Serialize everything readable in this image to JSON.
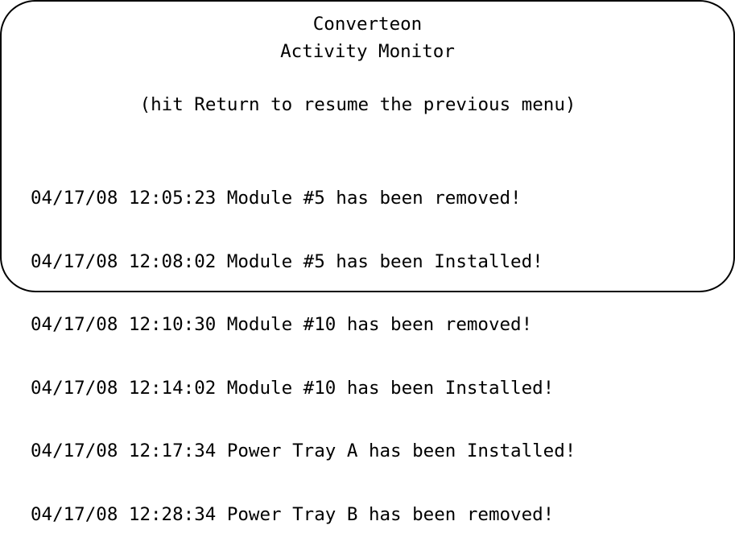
{
  "header": {
    "title": "Converteon",
    "subtitle": "Activity Monitor"
  },
  "hint": "(hit Return to resume the previous menu)",
  "log": [
    {
      "date": "04/17/08",
      "time": "12:05:23",
      "message": "Module #5 has been removed!"
    },
    {
      "date": "04/17/08",
      "time": "12:08:02",
      "message": "Module #5 has been Installed!"
    },
    {
      "date": "04/17/08",
      "time": "12:10:30",
      "message": "Module #10 has been removed!"
    },
    {
      "date": "04/17/08",
      "time": "12:14:02",
      "message": "Module #10 has been Installed!"
    },
    {
      "date": "04/17/08",
      "time": "12:17:34",
      "message": "Power Tray A has been Installed!"
    },
    {
      "date": "04/17/08",
      "time": "12:28:34",
      "message": "Power Tray B has been removed!"
    }
  ]
}
